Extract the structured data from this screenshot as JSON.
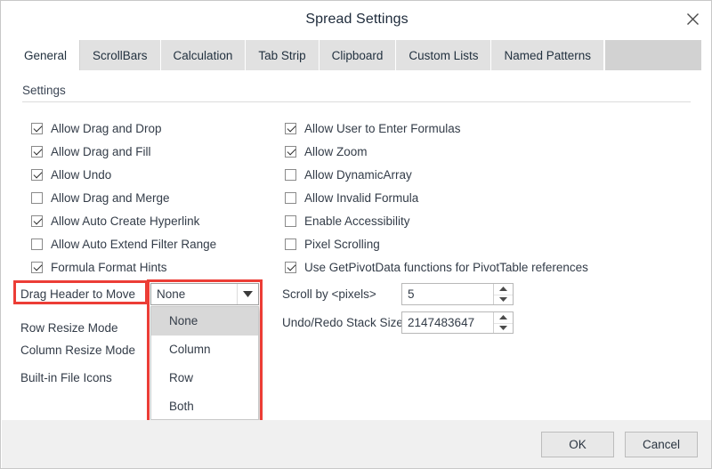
{
  "window": {
    "title": "Spread Settings",
    "close_icon": "close-icon"
  },
  "tabs": [
    {
      "label": "General",
      "active": true
    },
    {
      "label": "ScrollBars",
      "active": false
    },
    {
      "label": "Calculation",
      "active": false
    },
    {
      "label": "Tab Strip",
      "active": false
    },
    {
      "label": "Clipboard",
      "active": false
    },
    {
      "label": "Custom Lists",
      "active": false
    },
    {
      "label": "Named Patterns",
      "active": false
    }
  ],
  "group": {
    "label": "Settings"
  },
  "checkboxes_left": [
    {
      "label": "Allow Drag and Drop",
      "checked": true
    },
    {
      "label": "Allow Drag and Fill",
      "checked": true
    },
    {
      "label": "Allow Undo",
      "checked": true
    },
    {
      "label": "Allow Drag and Merge",
      "checked": false
    },
    {
      "label": "Allow Auto Create Hyperlink",
      "checked": true
    },
    {
      "label": "Allow Auto Extend Filter Range",
      "checked": false
    },
    {
      "label": "Formula Format Hints",
      "checked": true
    }
  ],
  "checkboxes_right": [
    {
      "label": "Allow User to Enter Formulas",
      "checked": true
    },
    {
      "label": "Allow Zoom",
      "checked": true
    },
    {
      "label": "Allow DynamicArray",
      "checked": false
    },
    {
      "label": "Allow Invalid Formula",
      "checked": false
    },
    {
      "label": "Enable Accessibility",
      "checked": false
    },
    {
      "label": "Pixel Scrolling",
      "checked": false
    },
    {
      "label": "Use GetPivotData functions for PivotTable references",
      "checked": true
    }
  ],
  "option_labels": [
    {
      "label": "Drag Header to Move",
      "highlighted": true
    },
    {
      "label": "Row Resize Mode",
      "highlighted": false
    },
    {
      "label": "Column Resize Mode",
      "highlighted": false
    },
    {
      "label": "Built-in File Icons",
      "highlighted": false
    }
  ],
  "combo": {
    "value": "None",
    "arrow_icon": "chevron-down-icon",
    "expanded": true,
    "options": [
      "None",
      "Column",
      "Row",
      "Both"
    ],
    "selected_index": 0
  },
  "spinners": [
    {
      "label": "Scroll by <pixels>",
      "value": "5"
    },
    {
      "label": "Undo/Redo Stack Size",
      "value": "2147483647"
    }
  ],
  "footer": {
    "ok_label": "OK",
    "cancel_label": "Cancel"
  },
  "colors": {
    "highlight": "#ec3d36",
    "tab_inactive_bg": "#e1e1e1",
    "tab_filler_bg": "#d2d2d2",
    "footer_bg": "#f0f0f0",
    "text": "#333c48",
    "combo_selected_bg": "#d8d8d8"
  }
}
